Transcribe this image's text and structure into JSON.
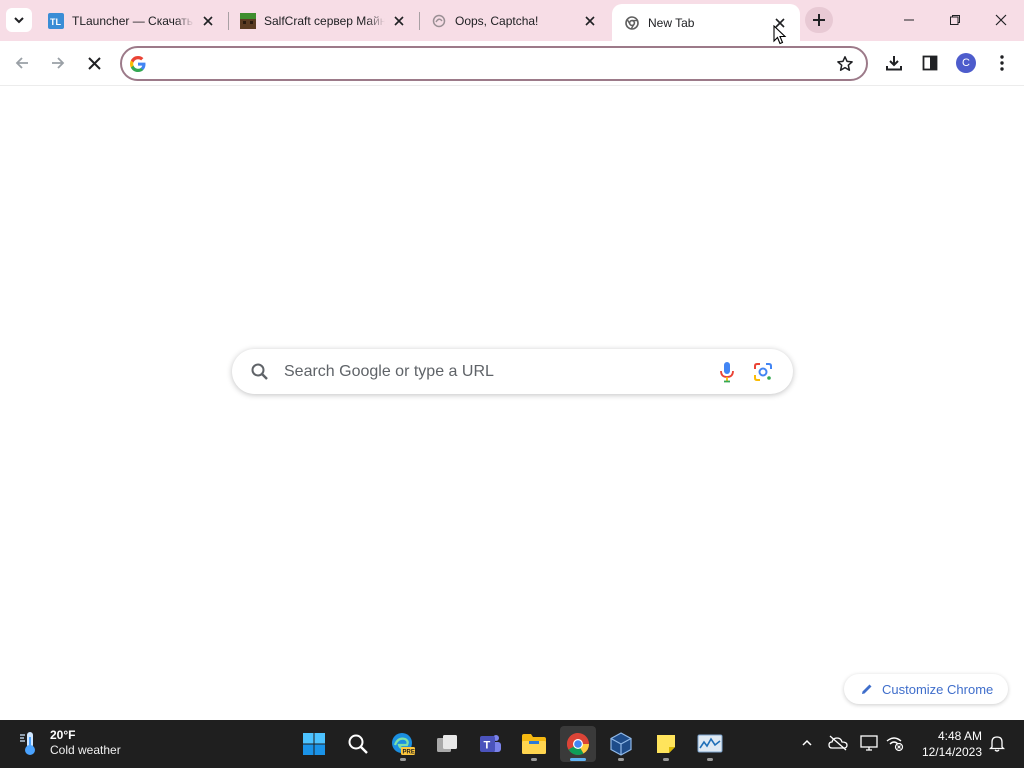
{
  "browser": {
    "tabs": [
      {
        "title": "TLauncher — Скачать",
        "favicon": "tlauncher-icon",
        "active": false
      },
      {
        "title": "SalfCraft сервер Майн",
        "favicon": "minecraft-icon",
        "active": false
      },
      {
        "title": "Oops, Captcha!",
        "favicon": "globe-icon",
        "active": false
      },
      {
        "title": "New Tab",
        "favicon": "chrome-icon",
        "active": true
      }
    ],
    "omnibox": {
      "value": "",
      "placeholder": ""
    },
    "profile_initial": "C",
    "accent_color": "#f7dde6"
  },
  "ntp": {
    "search_placeholder": "Search Google or type a URL",
    "customize_label": "Customize Chrome"
  },
  "taskbar": {
    "weather": {
      "temp": "20°F",
      "condition": "Cold weather"
    },
    "apps": [
      "start-icon",
      "search-icon",
      "edge-preview-icon",
      "task-view-icon",
      "teams-icon",
      "file-explorer-icon",
      "chrome-icon",
      "virtualbox-icon",
      "sticky-notes-icon",
      "resource-monitor-icon"
    ],
    "time": "4:48 AM",
    "date": "12/14/2023"
  }
}
